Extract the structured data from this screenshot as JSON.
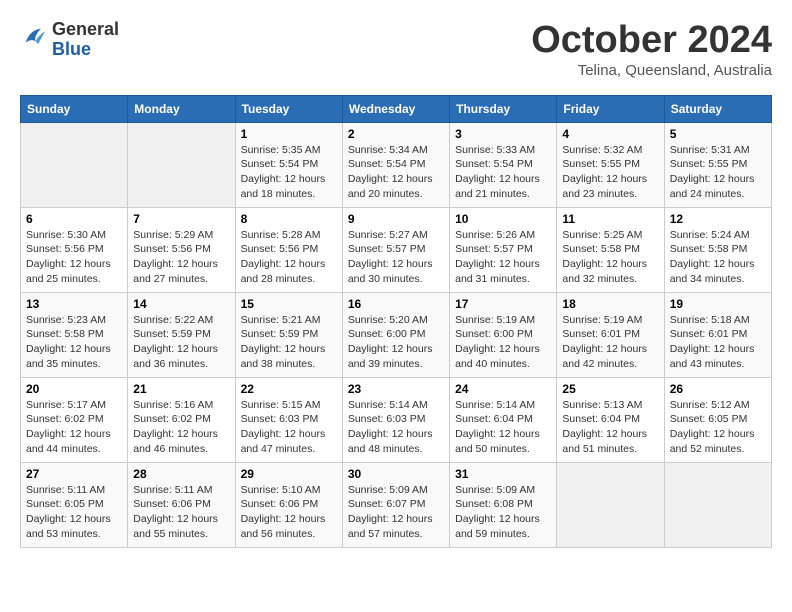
{
  "header": {
    "logo": {
      "line1": "General",
      "line2": "Blue"
    },
    "title": "October 2024",
    "subtitle": "Telina, Queensland, Australia"
  },
  "days_of_week": [
    "Sunday",
    "Monday",
    "Tuesday",
    "Wednesday",
    "Thursday",
    "Friday",
    "Saturday"
  ],
  "weeks": [
    [
      {
        "day": "",
        "sunrise": "",
        "sunset": "",
        "daylight": ""
      },
      {
        "day": "",
        "sunrise": "",
        "sunset": "",
        "daylight": ""
      },
      {
        "day": "1",
        "sunrise": "Sunrise: 5:35 AM",
        "sunset": "Sunset: 5:54 PM",
        "daylight": "Daylight: 12 hours and 18 minutes."
      },
      {
        "day": "2",
        "sunrise": "Sunrise: 5:34 AM",
        "sunset": "Sunset: 5:54 PM",
        "daylight": "Daylight: 12 hours and 20 minutes."
      },
      {
        "day": "3",
        "sunrise": "Sunrise: 5:33 AM",
        "sunset": "Sunset: 5:54 PM",
        "daylight": "Daylight: 12 hours and 21 minutes."
      },
      {
        "day": "4",
        "sunrise": "Sunrise: 5:32 AM",
        "sunset": "Sunset: 5:55 PM",
        "daylight": "Daylight: 12 hours and 23 minutes."
      },
      {
        "day": "5",
        "sunrise": "Sunrise: 5:31 AM",
        "sunset": "Sunset: 5:55 PM",
        "daylight": "Daylight: 12 hours and 24 minutes."
      }
    ],
    [
      {
        "day": "6",
        "sunrise": "Sunrise: 5:30 AM",
        "sunset": "Sunset: 5:56 PM",
        "daylight": "Daylight: 12 hours and 25 minutes."
      },
      {
        "day": "7",
        "sunrise": "Sunrise: 5:29 AM",
        "sunset": "Sunset: 5:56 PM",
        "daylight": "Daylight: 12 hours and 27 minutes."
      },
      {
        "day": "8",
        "sunrise": "Sunrise: 5:28 AM",
        "sunset": "Sunset: 5:56 PM",
        "daylight": "Daylight: 12 hours and 28 minutes."
      },
      {
        "day": "9",
        "sunrise": "Sunrise: 5:27 AM",
        "sunset": "Sunset: 5:57 PM",
        "daylight": "Daylight: 12 hours and 30 minutes."
      },
      {
        "day": "10",
        "sunrise": "Sunrise: 5:26 AM",
        "sunset": "Sunset: 5:57 PM",
        "daylight": "Daylight: 12 hours and 31 minutes."
      },
      {
        "day": "11",
        "sunrise": "Sunrise: 5:25 AM",
        "sunset": "Sunset: 5:58 PM",
        "daylight": "Daylight: 12 hours and 32 minutes."
      },
      {
        "day": "12",
        "sunrise": "Sunrise: 5:24 AM",
        "sunset": "Sunset: 5:58 PM",
        "daylight": "Daylight: 12 hours and 34 minutes."
      }
    ],
    [
      {
        "day": "13",
        "sunrise": "Sunrise: 5:23 AM",
        "sunset": "Sunset: 5:58 PM",
        "daylight": "Daylight: 12 hours and 35 minutes."
      },
      {
        "day": "14",
        "sunrise": "Sunrise: 5:22 AM",
        "sunset": "Sunset: 5:59 PM",
        "daylight": "Daylight: 12 hours and 36 minutes."
      },
      {
        "day": "15",
        "sunrise": "Sunrise: 5:21 AM",
        "sunset": "Sunset: 5:59 PM",
        "daylight": "Daylight: 12 hours and 38 minutes."
      },
      {
        "day": "16",
        "sunrise": "Sunrise: 5:20 AM",
        "sunset": "Sunset: 6:00 PM",
        "daylight": "Daylight: 12 hours and 39 minutes."
      },
      {
        "day": "17",
        "sunrise": "Sunrise: 5:19 AM",
        "sunset": "Sunset: 6:00 PM",
        "daylight": "Daylight: 12 hours and 40 minutes."
      },
      {
        "day": "18",
        "sunrise": "Sunrise: 5:19 AM",
        "sunset": "Sunset: 6:01 PM",
        "daylight": "Daylight: 12 hours and 42 minutes."
      },
      {
        "day": "19",
        "sunrise": "Sunrise: 5:18 AM",
        "sunset": "Sunset: 6:01 PM",
        "daylight": "Daylight: 12 hours and 43 minutes."
      }
    ],
    [
      {
        "day": "20",
        "sunrise": "Sunrise: 5:17 AM",
        "sunset": "Sunset: 6:02 PM",
        "daylight": "Daylight: 12 hours and 44 minutes."
      },
      {
        "day": "21",
        "sunrise": "Sunrise: 5:16 AM",
        "sunset": "Sunset: 6:02 PM",
        "daylight": "Daylight: 12 hours and 46 minutes."
      },
      {
        "day": "22",
        "sunrise": "Sunrise: 5:15 AM",
        "sunset": "Sunset: 6:03 PM",
        "daylight": "Daylight: 12 hours and 47 minutes."
      },
      {
        "day": "23",
        "sunrise": "Sunrise: 5:14 AM",
        "sunset": "Sunset: 6:03 PM",
        "daylight": "Daylight: 12 hours and 48 minutes."
      },
      {
        "day": "24",
        "sunrise": "Sunrise: 5:14 AM",
        "sunset": "Sunset: 6:04 PM",
        "daylight": "Daylight: 12 hours and 50 minutes."
      },
      {
        "day": "25",
        "sunrise": "Sunrise: 5:13 AM",
        "sunset": "Sunset: 6:04 PM",
        "daylight": "Daylight: 12 hours and 51 minutes."
      },
      {
        "day": "26",
        "sunrise": "Sunrise: 5:12 AM",
        "sunset": "Sunset: 6:05 PM",
        "daylight": "Daylight: 12 hours and 52 minutes."
      }
    ],
    [
      {
        "day": "27",
        "sunrise": "Sunrise: 5:11 AM",
        "sunset": "Sunset: 6:05 PM",
        "daylight": "Daylight: 12 hours and 53 minutes."
      },
      {
        "day": "28",
        "sunrise": "Sunrise: 5:11 AM",
        "sunset": "Sunset: 6:06 PM",
        "daylight": "Daylight: 12 hours and 55 minutes."
      },
      {
        "day": "29",
        "sunrise": "Sunrise: 5:10 AM",
        "sunset": "Sunset: 6:06 PM",
        "daylight": "Daylight: 12 hours and 56 minutes."
      },
      {
        "day": "30",
        "sunrise": "Sunrise: 5:09 AM",
        "sunset": "Sunset: 6:07 PM",
        "daylight": "Daylight: 12 hours and 57 minutes."
      },
      {
        "day": "31",
        "sunrise": "Sunrise: 5:09 AM",
        "sunset": "Sunset: 6:08 PM",
        "daylight": "Daylight: 12 hours and 59 minutes."
      },
      {
        "day": "",
        "sunrise": "",
        "sunset": "",
        "daylight": ""
      },
      {
        "day": "",
        "sunrise": "",
        "sunset": "",
        "daylight": ""
      }
    ]
  ]
}
